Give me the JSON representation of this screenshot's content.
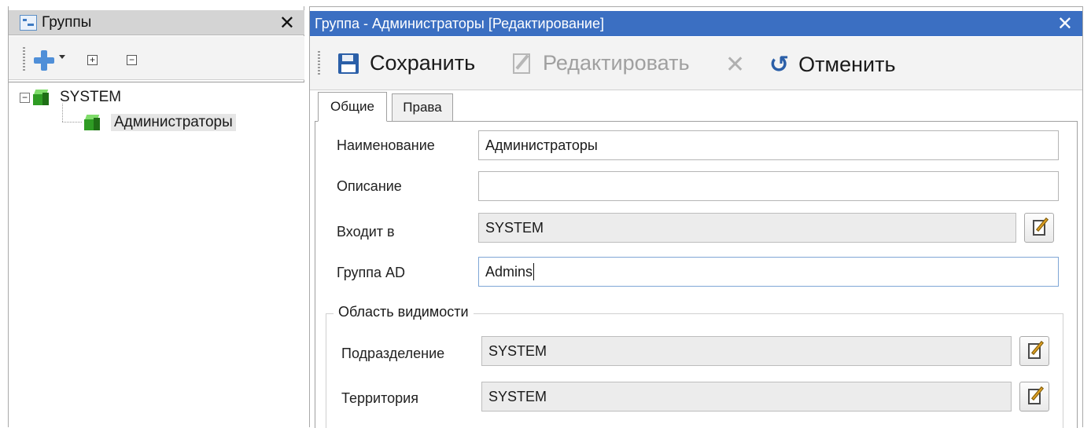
{
  "left_panel": {
    "title": "Группы",
    "close_glyph": "✕",
    "toolbar": {
      "add_icon": "add-plus-icon",
      "expand_glyph": "+",
      "collapse_glyph": "−"
    },
    "tree": {
      "root": {
        "expander_glyph": "−",
        "label": "SYSTEM"
      },
      "child": {
        "label": "Администраторы"
      }
    }
  },
  "right_panel": {
    "title": "Группа - Администраторы [Редактирование]",
    "close_glyph": "✕",
    "toolbar": {
      "save_label": "Сохранить",
      "edit_label": "Редактировать",
      "delete_glyph": "✕",
      "cancel_label": "Отменить"
    },
    "tabs": [
      {
        "label": "Общие",
        "active": true
      },
      {
        "label": "Права",
        "active": false
      }
    ],
    "form": {
      "name_label": "Наименование",
      "name_value": "Администраторы",
      "description_label": "Описание",
      "description_value": "",
      "parent_label": "Входит в",
      "parent_value": "SYSTEM",
      "ad_group_label": "Группа AD",
      "ad_group_value": "Admins"
    },
    "visibility": {
      "title": "Область видимости",
      "division_label": "Подразделение",
      "division_value": "SYSTEM",
      "territory_label": "Территория",
      "territory_value": "SYSTEM"
    }
  },
  "colors": {
    "active_header": "#3b6fc2",
    "inactive_header": "#d4d4d4",
    "cube_green": "#2f9c24",
    "save_blue": "#2b5fa8"
  }
}
